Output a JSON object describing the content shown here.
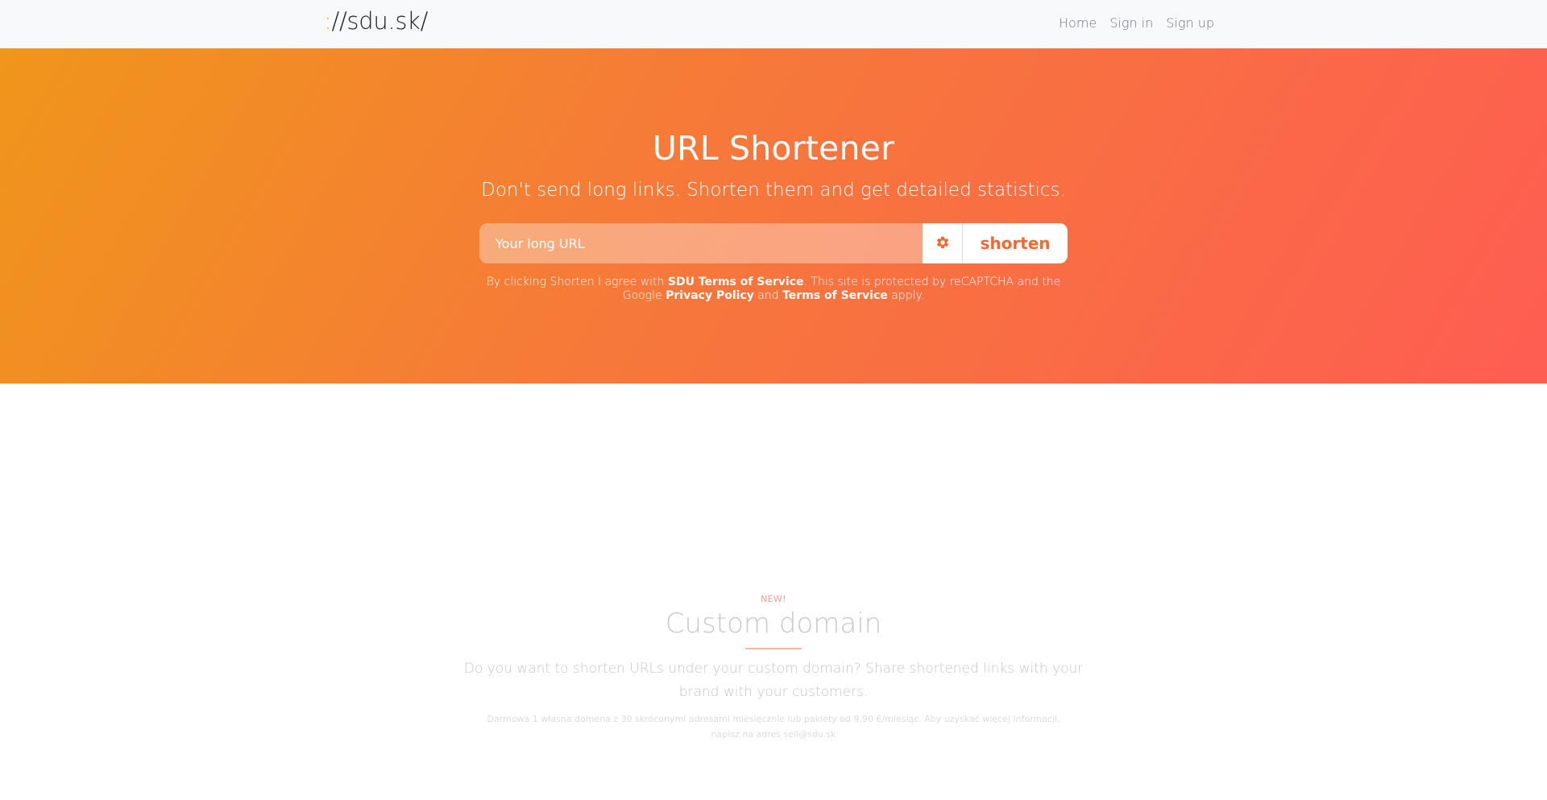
{
  "nav": {
    "brand_colon": ":",
    "brand_rest": "//sdu.sk/",
    "links": [
      "Home",
      "Sign in",
      "Sign up"
    ]
  },
  "hero": {
    "title": "URL Shortener",
    "subtitle": "Don't send long links. Shorten them and get detailed statistics.",
    "input_placeholder": "Your long URL",
    "settings_icon": "gear-icon",
    "shorten_label": "shorten",
    "legal": {
      "part1": "By clicking Shorten I agree with ",
      "link1": "SDU Terms of Service",
      "part2": ". This site is protected by reCAPTCHA and the Google ",
      "link2": "Privacy Policy",
      "part3": " and ",
      "link3": "Terms of Service",
      "part4": " apply."
    }
  },
  "feature": {
    "badge": "NEW!",
    "title": "Custom domain",
    "description": "Do you want to shorten URLs under your custom domain? Share shortened links with your brand with your customers.",
    "small_text": "Darmowa 1 własna domena z 30 skróconymi adresami miesięcznie lub pakiety od 9,90 €/miesiąc. Aby uzyskać więcej informacji, napisz na adres sell@sdu.sk"
  },
  "colors": {
    "accent": "#f26a30",
    "gradient_start": "#f0961b",
    "gradient_end": "#fe5d52",
    "brand_colon": "#f39c12"
  }
}
